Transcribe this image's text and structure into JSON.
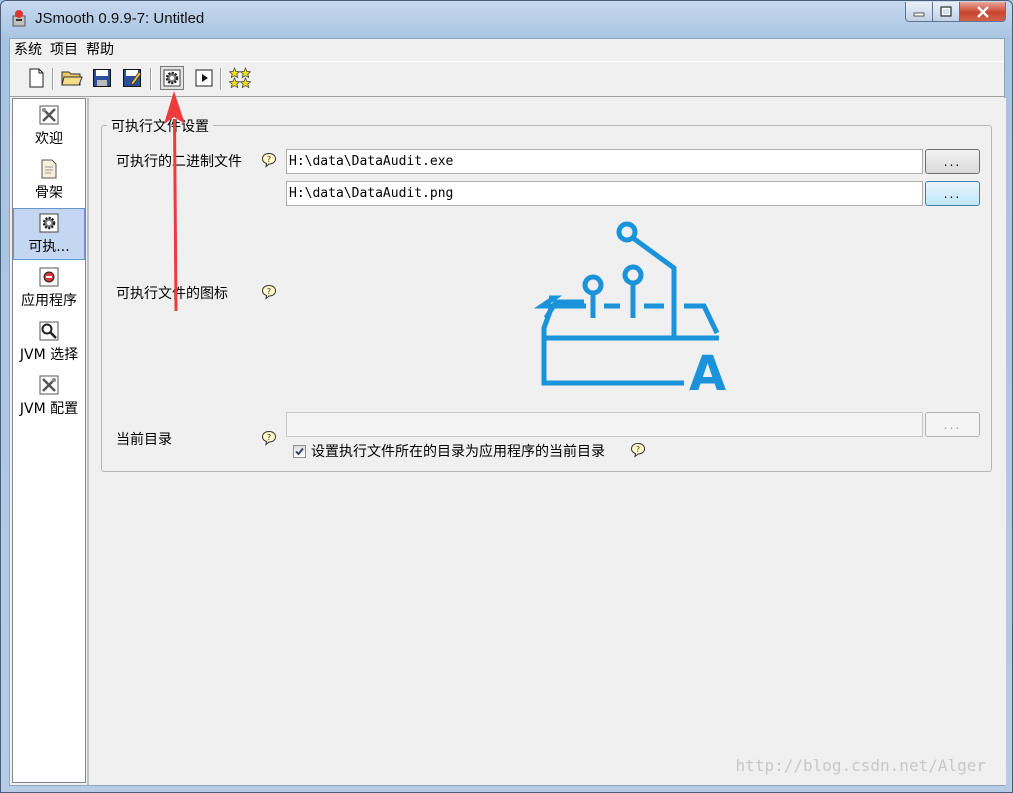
{
  "window": {
    "title": "JSmooth 0.9.9-7: Untitled"
  },
  "menu": {
    "items": [
      "系统",
      "项目",
      "帮助"
    ]
  },
  "toolbar": {
    "icons": [
      "new-file-icon",
      "open-folder-icon",
      "save-icon",
      "save-as-icon",
      "compile-gear-icon",
      "run-icon",
      "stars-icon"
    ]
  },
  "sidebar": {
    "items": [
      {
        "label": "欢迎",
        "icon": "welcome-tools-icon"
      },
      {
        "label": "骨架",
        "icon": "skeleton-page-icon"
      },
      {
        "label": "可执...",
        "icon": "executable-gear-icon",
        "selected": true
      },
      {
        "label": "应用程序",
        "icon": "application-icon"
      },
      {
        "label": "JVM 选择",
        "icon": "jvm-select-magnifier-icon"
      },
      {
        "label": "JVM 配置",
        "icon": "jvm-config-tools-icon"
      }
    ]
  },
  "panel": {
    "group_title": "可执行文件设置",
    "binary_label": "可执行的二进制文件",
    "binary_value": "H:\\data\\DataAudit.exe",
    "icon_label": "可执行文件的图标",
    "icon_value": "H:\\data\\DataAudit.png",
    "browse_label": "...",
    "cwd_label": "当前目录",
    "cwd_value": "",
    "checkbox_label": "设置执行文件所在的目录为应用程序的当前目录",
    "checkbox_checked": true
  },
  "preview": {
    "icon": "data-audit-logo-icon",
    "letter": "A",
    "color": "#1a93db"
  },
  "annotation": {
    "arrow_color": "#ee3b3b"
  },
  "watermark": "http://blog.csdn.net/Alger"
}
